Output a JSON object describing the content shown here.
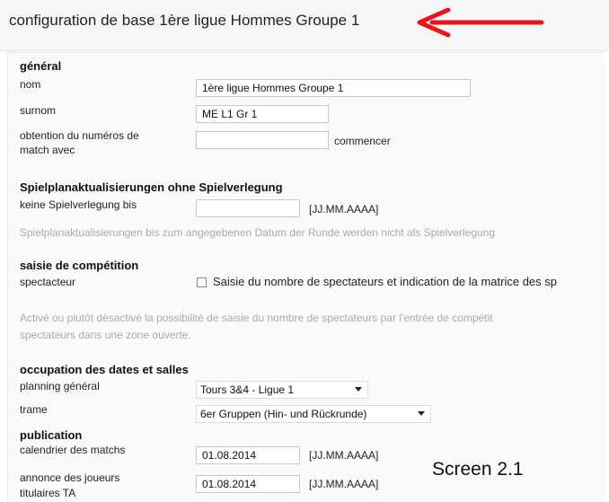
{
  "header": {
    "title": "configuration de base 1ère ligue Hommes Groupe 1",
    "arrow_color": "#e8141b"
  },
  "general": {
    "heading": "général",
    "name_label": "nom",
    "name_value": "1ère ligue Hommes Groupe 1",
    "nickname_label": "surnom",
    "nickname_value": "ME L1 Gr 1",
    "match_numbers_label_1": "obtention du numéros de",
    "match_numbers_label_2": "match avec",
    "match_numbers_value": "",
    "match_numbers_suffix": "commencer"
  },
  "schedule_updates": {
    "heading": "Spielplanaktualisierungen ohne Spielverlegung",
    "no_postpone_label": "keine Spielverlegung bis",
    "no_postpone_value": "",
    "date_format": "[JJ.MM.AAAA]",
    "hint": "Spielplanaktualisierungen bis zum angegebenen Datum der Runde werden nicht als Spielverlegung"
  },
  "competition_entry": {
    "heading": "saisie de compétition",
    "spectator_label": "spectacteur",
    "spectator_checked": false,
    "spectator_checkbox_text": "Saisie du nombre de spectateurs et indication de la matrice des sp",
    "hint_line_1": "Activé ou plutôt désactivé la possibilité de saisie du nombre de spectateurs par l'entrée de compétit",
    "hint_line_2": "spectateurs dans une zone ouverte."
  },
  "occupation": {
    "heading": "occupation des dates et salles",
    "planning_label": "planning général",
    "planning_value": "Tours 3&4 - Ligue 1",
    "trame_label": "trame",
    "trame_value": "6er Gruppen (Hin- und Rückrunde)"
  },
  "publication": {
    "heading": "publication",
    "calendar_label": "calendrier des matchs",
    "calendar_value": "01.08.2014",
    "calendar_format": "[JJ.MM.AAAA]",
    "players_label_1": "annonce des joueurs",
    "players_label_2": "titulaires TA",
    "players_value": "01.08.2014",
    "players_format": "[JJ.MM.AAAA]"
  },
  "annotation": {
    "screen_label": "Screen 2.1"
  }
}
